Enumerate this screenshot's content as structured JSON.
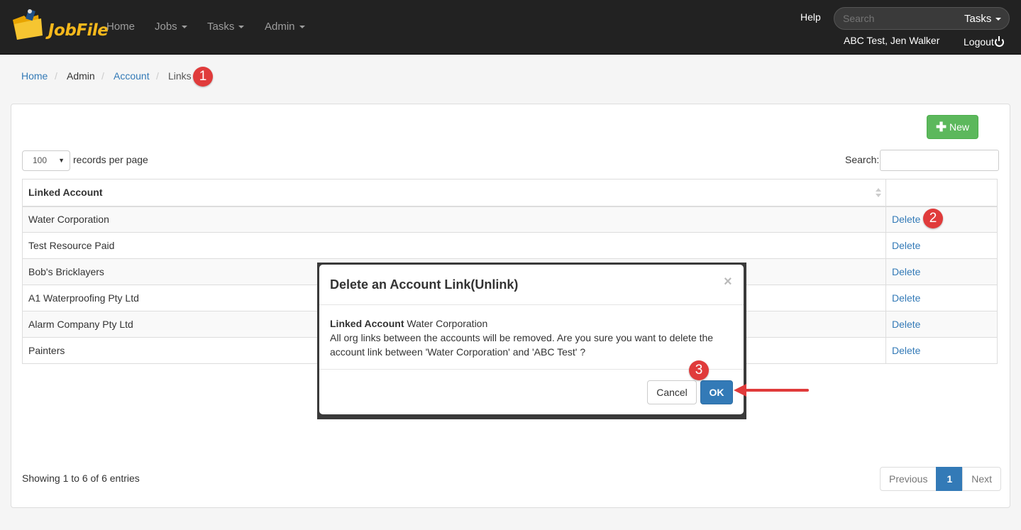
{
  "brand": {
    "name": "JobFile"
  },
  "nav": {
    "home": "Home",
    "jobs": "Jobs",
    "tasks": "Tasks",
    "admin": "Admin",
    "help": "Help",
    "search_placeholder": "Search",
    "search_scope": "Tasks",
    "user": "ABC Test, Jen Walker",
    "logout": "Logout"
  },
  "breadcrumb": {
    "home": "Home",
    "admin": "Admin",
    "account": "Account",
    "current": "Links",
    "sep": "/"
  },
  "markers": {
    "m1": "1",
    "m2": "2",
    "m3": "3"
  },
  "toolbar": {
    "new_label": "New",
    "page_length": "100",
    "page_length_label": "records per page",
    "search_label": "Search:"
  },
  "table": {
    "header": "Linked Account",
    "action_label": "Delete",
    "rows": [
      {
        "account": "Water Corporation"
      },
      {
        "account": "Test Resource Paid"
      },
      {
        "account": "Bob's Bricklayers"
      },
      {
        "account": "A1 Waterproofing Pty Ltd"
      },
      {
        "account": "Alarm Company Pty Ltd"
      },
      {
        "account": "Painters"
      }
    ]
  },
  "footer": {
    "info": "Showing 1 to 6 of 6 entries",
    "prev": "Previous",
    "page": "1",
    "next": "Next"
  },
  "modal": {
    "title": "Delete an Account Link(Unlink)",
    "close": "×",
    "field_label": "Linked Account",
    "field_value": "Water Corporation",
    "message": "All org links between the accounts will be removed. Are you sure you want to delete the account link between 'Water Corporation' and 'ABC Test' ?",
    "cancel": "Cancel",
    "ok": "OK"
  },
  "colors": {
    "navbar": "#222222",
    "link": "#337ab7",
    "success": "#5cb85c",
    "primary": "#337ab7",
    "marker": "#e03b3b"
  }
}
